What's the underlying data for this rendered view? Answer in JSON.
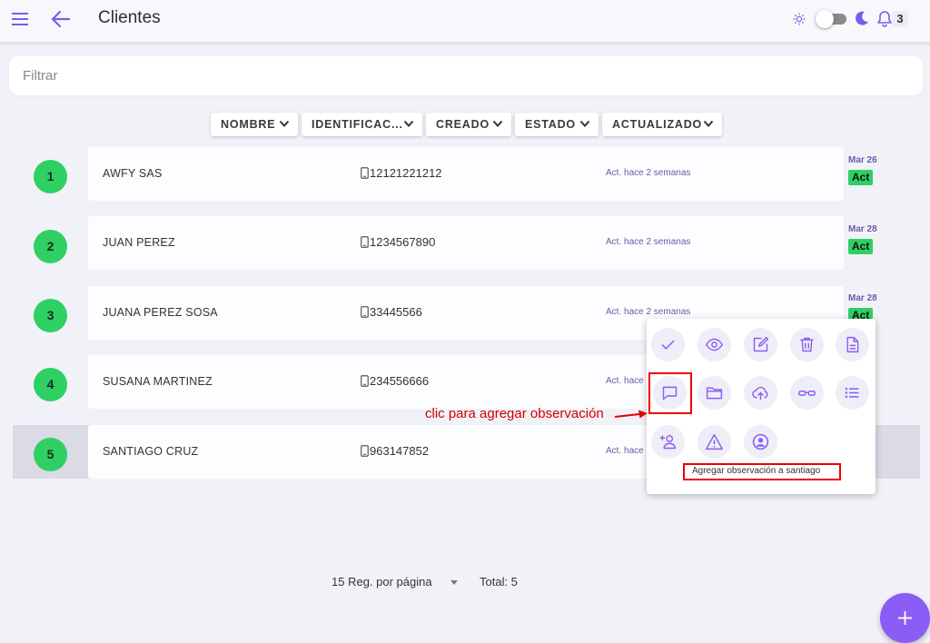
{
  "header": {
    "title": "Clientes",
    "notifications": "3"
  },
  "filter": {
    "placeholder": "Filtrar"
  },
  "sort_buttons": [
    "NOMBRE",
    "IDENTIFICAC...",
    "CREADO",
    "ESTADO",
    "ACTUALIZADO"
  ],
  "rows": [
    {
      "num": "1",
      "name": "AWFY SAS",
      "id": "12121221212",
      "updated": "Act. hace 2 semanas",
      "date": "Mar 26",
      "status": "Act"
    },
    {
      "num": "2",
      "name": "JUAN PEREZ",
      "id": "1234567890",
      "updated": "Act. hace 2 semanas",
      "date": "Mar 28",
      "status": "Act"
    },
    {
      "num": "3",
      "name": "JUANA PEREZ SOSA",
      "id": "33445566",
      "updated": "Act. hace 2 semanas",
      "date": "Mar 28",
      "status": "Act"
    },
    {
      "num": "4",
      "name": "SUSANA MARTINEZ",
      "id": "234556666",
      "updated": "Act. hace"
    },
    {
      "num": "5",
      "name": "SANTIAGO CRUZ",
      "id": "963147852",
      "updated": "Act. hace"
    }
  ],
  "popup": {
    "actions": [
      "check-icon",
      "eye-icon",
      "edit-icon",
      "trash-icon",
      "document-icon",
      "comment-icon",
      "folder-icon",
      "cloud-upload-icon",
      "glasses-icon",
      "list-icon",
      "add-user-icon",
      "warning-icon",
      "user-circle-icon"
    ],
    "tooltip": "Agregar observación a santiago"
  },
  "annotation": {
    "text": "clic para agregar observación"
  },
  "pagination": {
    "per_page": "15 Reg. por página",
    "total": "Total: 5"
  },
  "colors": {
    "accent": "#8b5cf6",
    "status_green": "#2ed064",
    "annotation_red": "#e00000"
  }
}
